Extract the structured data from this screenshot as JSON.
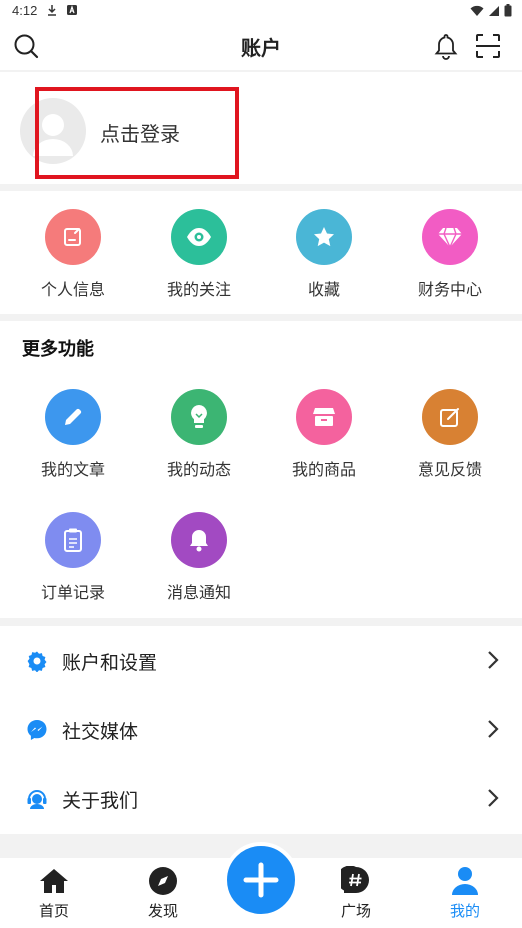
{
  "status_bar": {
    "time": "4:12"
  },
  "header": {
    "title": "账户"
  },
  "login": {
    "text": "点击登录"
  },
  "quick_actions": [
    {
      "label": "个人信息",
      "color": "#f57b7b",
      "icon": "edit-doc-icon"
    },
    {
      "label": "我的关注",
      "color": "#2cbf9a",
      "icon": "eye-icon"
    },
    {
      "label": "收藏",
      "color": "#4ab6d6",
      "icon": "star-icon"
    },
    {
      "label": "财务中心",
      "color": "#f25cc4",
      "icon": "diamond-icon"
    }
  ],
  "more": {
    "title": "更多功能",
    "items": [
      {
        "label": "我的文章",
        "color": "#3d97ee",
        "icon": "pencil-icon"
      },
      {
        "label": "我的动态",
        "color": "#3cb573",
        "icon": "bulb-icon"
      },
      {
        "label": "我的商品",
        "color": "#f4629e",
        "icon": "store-icon"
      },
      {
        "label": "意见反馈",
        "color": "#d88133",
        "icon": "edit-icon"
      },
      {
        "label": "订单记录",
        "color": "#7f8cf0",
        "icon": "clipboard-icon"
      },
      {
        "label": "消息通知",
        "color": "#a24ac2",
        "icon": "bell-icon"
      }
    ]
  },
  "list": [
    {
      "label": "账户和设置",
      "icon": "gear-icon"
    },
    {
      "label": "社交媒体",
      "icon": "messenger-icon"
    },
    {
      "label": "关于我们",
      "icon": "support-agent-icon"
    }
  ],
  "tabs": [
    {
      "label": "首页",
      "icon": "home-icon"
    },
    {
      "label": "发现",
      "icon": "compass-icon"
    },
    {
      "label": "广场",
      "icon": "hashtag-icon"
    },
    {
      "label": "我的",
      "icon": "person-icon",
      "active": true
    }
  ],
  "colors": {
    "accent": "#1a8cf5",
    "highlight_box": "#e0151f"
  }
}
